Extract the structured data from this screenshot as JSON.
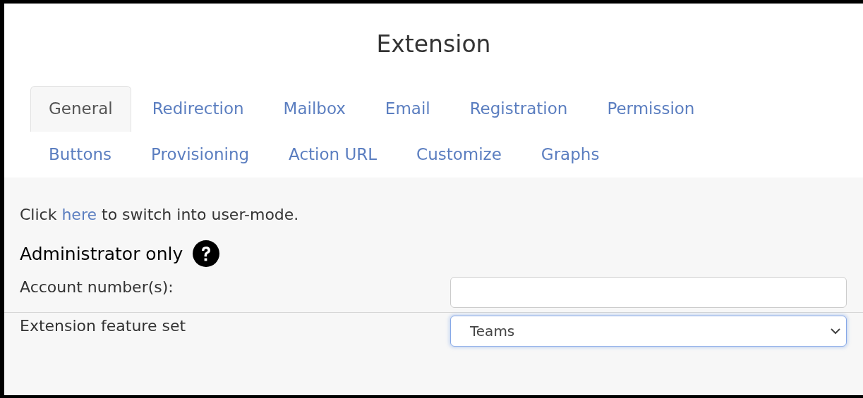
{
  "title": "Extension",
  "tabs": [
    {
      "label": "General",
      "selected": true
    },
    {
      "label": "Redirection",
      "selected": false
    },
    {
      "label": "Mailbox",
      "selected": false
    },
    {
      "label": "Email",
      "selected": false
    },
    {
      "label": "Registration",
      "selected": false
    },
    {
      "label": "Permission",
      "selected": false
    },
    {
      "label": "Buttons",
      "selected": false
    },
    {
      "label": "Provisioning",
      "selected": false
    },
    {
      "label": "Action URL",
      "selected": false
    },
    {
      "label": "Customize",
      "selected": false
    },
    {
      "label": "Graphs",
      "selected": false
    }
  ],
  "notice": {
    "before": "Click",
    "link": "here",
    "after": "to switch into user-mode."
  },
  "section": {
    "heading": "Administrator only",
    "settings": [
      {
        "kind": "text",
        "label": "Account number(s):"
      },
      {
        "kind": "select",
        "label": "Extension feature set",
        "value": "Teams",
        "focused": true
      }
    ]
  }
}
